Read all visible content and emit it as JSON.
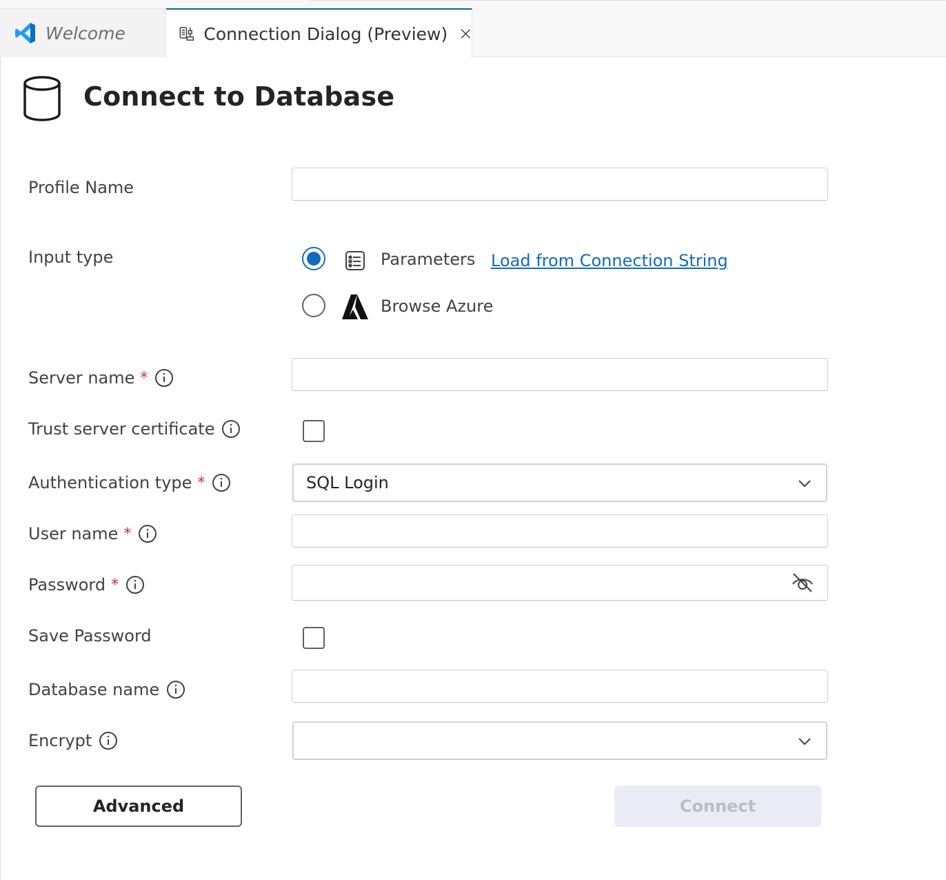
{
  "tabs": [
    {
      "label": "Welcome",
      "icon": "vscode-icon",
      "active": false
    },
    {
      "label": "Connection Dialog (Preview)",
      "icon": "connection-dialog-icon",
      "active": true
    }
  ],
  "header": {
    "title": "Connect to Database",
    "icon": "database-icon"
  },
  "form": {
    "profile_name": {
      "label": "Profile Name",
      "value": ""
    },
    "input_type": {
      "label": "Input type",
      "options": [
        {
          "label": "Parameters",
          "icon": "form-icon",
          "selected": true
        },
        {
          "label": "Browse Azure",
          "icon": "azure-icon",
          "selected": false
        }
      ],
      "load_link": "Load from Connection String"
    },
    "server_name": {
      "label": "Server name",
      "required": "*",
      "value": ""
    },
    "trust_cert": {
      "label": "Trust server certificate",
      "checked": false
    },
    "auth_type": {
      "label": "Authentication type",
      "required": "*",
      "value": "SQL Login"
    },
    "user_name": {
      "label": "User name",
      "required": "*",
      "value": ""
    },
    "password": {
      "label": "Password",
      "required": "*",
      "value": "",
      "icon": "eye-off-icon"
    },
    "save_password": {
      "label": "Save Password",
      "checked": false
    },
    "database_name": {
      "label": "Database name",
      "value": ""
    },
    "encrypt": {
      "label": "Encrypt",
      "value": ""
    }
  },
  "buttons": {
    "advanced": "Advanced",
    "connect": "Connect"
  },
  "colors": {
    "accent": "#0f6cbd",
    "required": "#c4314b",
    "tab_active_border": "#0e639c",
    "vscode_blue": "#1f9cf0",
    "disabled_bg": "#ebebf5"
  }
}
